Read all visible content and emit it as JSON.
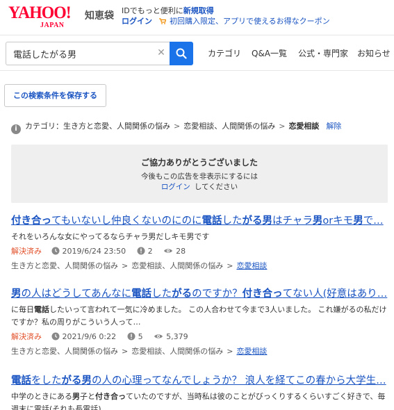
{
  "header": {
    "logo_yahoo": "YAHOO!",
    "logo_japan": "JAPAN",
    "logo_chie": "知恵袋",
    "promo_prefix": "IDでもっと便利に",
    "promo_register": "新規取得",
    "promo_login": "ログイン",
    "promo_text": "初回購入限定、アプリで使えるお得なクーポン"
  },
  "search": {
    "value": "電話したがる男",
    "placeholder": ""
  },
  "nav": [
    "カテゴリ",
    "Q&A一覧",
    "公式・専門家",
    "お知らせ"
  ],
  "save_condition": "この検索条件を保存する",
  "category": {
    "prefix": "カテゴリ：",
    "path": [
      "生き方と恋愛、人間関係の悩み",
      "恋愛相談、人間関係の悩み",
      "恋愛相談"
    ],
    "clear": "解除"
  },
  "ad": {
    "title": "ご協力ありがとうございました",
    "line1": "今後もこの広告を非表示にするには",
    "login": "ログイン",
    "line2_suffix": "してください"
  },
  "results": [
    {
      "title_parts": [
        {
          "t": "付き合っ",
          "b": true
        },
        {
          "t": "てもいないし仲良くないのにのに",
          "b": false
        },
        {
          "t": "電話",
          "b": true
        },
        {
          "t": "した",
          "b": false
        },
        {
          "t": "がる男",
          "b": true
        },
        {
          "t": "はチャラ",
          "b": false
        },
        {
          "t": "男",
          "b": true
        },
        {
          "t": "orキモ",
          "b": false
        },
        {
          "t": "男",
          "b": true
        },
        {
          "t": "で…",
          "b": false
        }
      ],
      "snippet_parts": [
        {
          "t": "それをいろんな女にやってるならチャラ男だしキモ男です",
          "b": false
        }
      ],
      "status": "解決済み",
      "date": "2019/6/24 23:50",
      "answers": "2",
      "views": "28",
      "path": [
        "生き方と恋愛、人間関係の悩み",
        "恋愛相談、人間関係の悩み",
        "恋愛相談"
      ]
    },
    {
      "title_parts": [
        {
          "t": "男",
          "b": true
        },
        {
          "t": "の人はどうしてあんなに",
          "b": false
        },
        {
          "t": "電話",
          "b": true
        },
        {
          "t": "した",
          "b": false
        },
        {
          "t": "がる",
          "b": true
        },
        {
          "t": "のですか？",
          "b": false
        },
        {
          "t": "付き合っ",
          "b": true
        },
        {
          "t": "てない人(好意はあり…",
          "b": false
        }
      ],
      "snippet_parts": [
        {
          "t": "に毎日",
          "b": false
        },
        {
          "t": "電話",
          "b": true
        },
        {
          "t": "したいって言われて一気に冷めました。 この人合わせて今まで3人いました。 これ嫌がるの私だけですか？私の周りがこういう人って…",
          "b": false
        }
      ],
      "status": "解決済み",
      "date": "2021/9/6 0:22",
      "answers": "5",
      "views": "5,379",
      "path": [
        "生き方と恋愛、人間関係の悩み",
        "恋愛相談、人間関係の悩み",
        "恋愛相談"
      ]
    },
    {
      "title_parts": [
        {
          "t": "電話",
          "b": true
        },
        {
          "t": "をした",
          "b": false
        },
        {
          "t": "がる男",
          "b": true
        },
        {
          "t": "の人の心理ってなんでしょうか？ 浪人を経てこの春から大学生…",
          "b": false
        }
      ],
      "snippet_parts": [
        {
          "t": "中学のときにある",
          "b": false
        },
        {
          "t": "男",
          "b": true
        },
        {
          "t": "子と",
          "b": false
        },
        {
          "t": "付き合っ",
          "b": true
        },
        {
          "t": "ていたのですが、当時私は彼のことがびっくりするくらいすごく好きで、毎週末に電話(それも長電話)",
          "b": false
        }
      ]
    }
  ]
}
